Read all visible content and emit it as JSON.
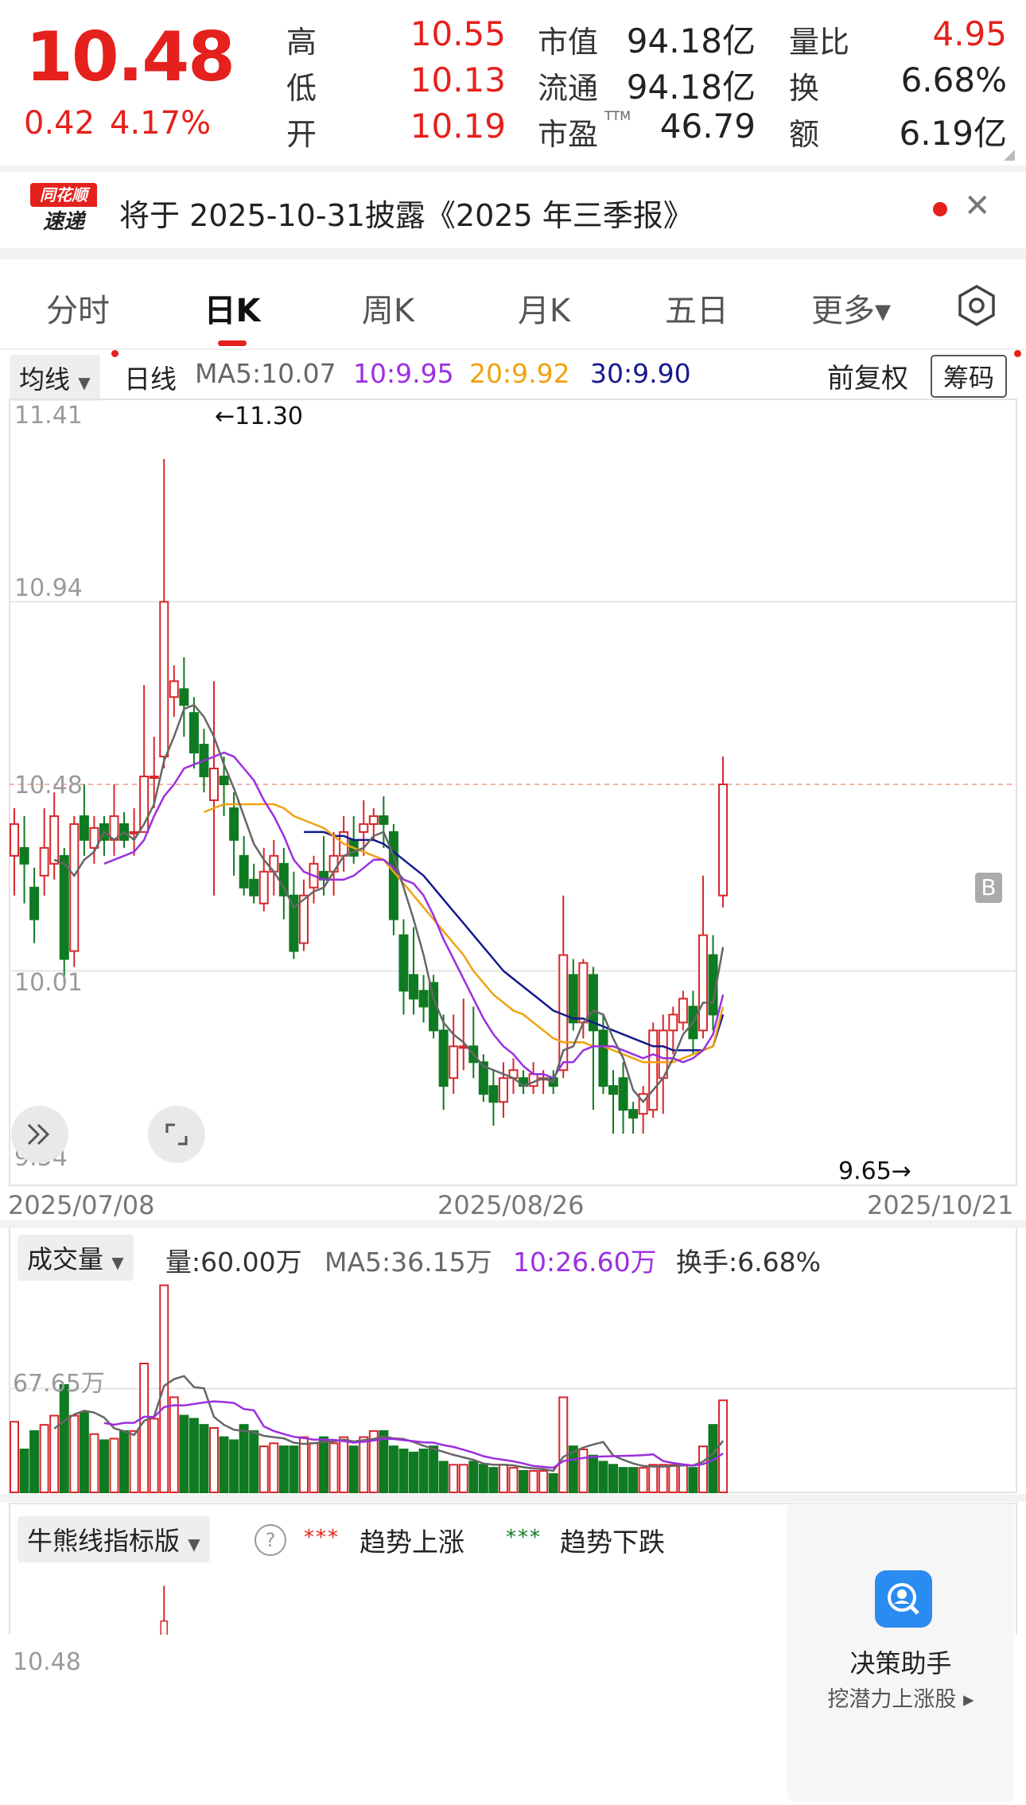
{
  "quote": {
    "price": "10.48",
    "change": "0.42",
    "change_pct": "4.17%",
    "stats": [
      {
        "label": "高",
        "value": "10.55",
        "color": "red"
      },
      {
        "label": "低",
        "value": "10.13",
        "color": "red"
      },
      {
        "label": "开",
        "value": "10.19",
        "color": "red"
      },
      {
        "label": "市值",
        "value": "94.18亿",
        "color": "dark"
      },
      {
        "label": "流通",
        "value": "94.18亿",
        "color": "dark"
      },
      {
        "label": "市盈",
        "value": "46.79",
        "color": "dark"
      },
      {
        "label": "量比",
        "value": "4.95",
        "color": "red"
      },
      {
        "label": "换",
        "value": "6.68%",
        "color": "dark"
      },
      {
        "label": "额",
        "value": "6.19亿",
        "color": "dark"
      }
    ],
    "ttm": "TTM"
  },
  "notice": {
    "logo_top": "同花顺",
    "logo_bottom": "速递",
    "text": "将于 2025-10-31披露《2025 年三季报》"
  },
  "tabs": [
    "分时",
    "日K",
    "周K",
    "月K",
    "五日",
    "更多▾"
  ],
  "active_tab": "日K",
  "kline": {
    "ma_selector": "均线",
    "period_label": "日线",
    "ma5": "MA5:10.07",
    "ma10": "10:9.95",
    "ma20": "20:9.92",
    "ma30": "30:9.90",
    "adjust": "前复权",
    "chips": "筹码",
    "y_ticks": [
      "11.41",
      "10.94",
      "10.48",
      "10.01",
      "9.54"
    ],
    "max_label": "←11.30",
    "min_label": "9.65→",
    "b_marker": "B",
    "dates": [
      "2025/07/08",
      "2025/08/26",
      "2025/10/21"
    ]
  },
  "volume": {
    "selector": "成交量",
    "vol": "量:60.00万",
    "ma5": "MA5:36.15万",
    "ma10": "10:26.60万",
    "turnover": "换手:6.68%",
    "y_tick": "67.65万"
  },
  "bullbear": {
    "selector": "牛熊线指标版",
    "help": "?",
    "legend_up": "趋势上涨",
    "legend_down": "趋势下跌",
    "y_tick": "10.48"
  },
  "helper": {
    "title": "决策助手",
    "subtitle": "挖潜力上涨股 ▸"
  },
  "colors": {
    "up": "#d8262b",
    "down": "#0e7a21",
    "ma5": "#666666",
    "ma10": "#9b30e0",
    "ma20": "#f0a20f",
    "ma30": "#151a8c"
  },
  "chart_data": {
    "type": "candlestick",
    "y_range": [
      9.54,
      11.41
    ],
    "dates": [
      "2025/07/08",
      "2025/08/26",
      "2025/10/21"
    ],
    "candles": [
      [
        10.3,
        10.38,
        10.2,
        10.42
      ],
      [
        10.32,
        10.28,
        10.18,
        10.4
      ],
      [
        10.22,
        10.14,
        10.08,
        10.27
      ],
      [
        10.25,
        10.32,
        10.2,
        10.42
      ],
      [
        10.28,
        10.4,
        10.24,
        10.46
      ],
      [
        10.3,
        10.04,
        9.98,
        10.32
      ],
      [
        10.06,
        10.38,
        10.02,
        10.4
      ],
      [
        10.4,
        10.34,
        10.3,
        10.48
      ],
      [
        10.32,
        10.37,
        10.28,
        10.4
      ],
      [
        10.38,
        10.34,
        10.3,
        10.4
      ],
      [
        10.34,
        10.4,
        10.3,
        10.48
      ],
      [
        10.38,
        10.34,
        10.32,
        10.41
      ],
      [
        10.36,
        10.36,
        10.3,
        10.42
      ],
      [
        10.36,
        10.5,
        10.44,
        10.73
      ],
      [
        10.5,
        10.5,
        10.42,
        10.6
      ],
      [
        10.55,
        10.94,
        10.52,
        11.3
      ],
      [
        10.7,
        10.74,
        10.65,
        10.78
      ],
      [
        10.72,
        10.68,
        10.6,
        10.8
      ],
      [
        10.66,
        10.56,
        10.52,
        10.7
      ],
      [
        10.58,
        10.5,
        10.46,
        10.62
      ],
      [
        10.44,
        10.52,
        10.2,
        10.74
      ],
      [
        10.5,
        10.48,
        10.4,
        10.55
      ],
      [
        10.42,
        10.34,
        10.25,
        10.46
      ],
      [
        10.3,
        10.22,
        10.2,
        10.35
      ],
      [
        10.24,
        10.2,
        10.18,
        10.28
      ],
      [
        10.18,
        10.26,
        10.16,
        10.32
      ],
      [
        10.26,
        10.3,
        10.2,
        10.34
      ],
      [
        10.28,
        10.2,
        10.14,
        10.32
      ],
      [
        10.2,
        10.06,
        10.04,
        10.26
      ],
      [
        10.08,
        10.2,
        10.06,
        10.24
      ],
      [
        10.22,
        10.28,
        10.18,
        10.3
      ],
      [
        10.26,
        10.24,
        10.2,
        10.35
      ],
      [
        10.26,
        10.3,
        10.2,
        10.36
      ],
      [
        10.3,
        10.36,
        10.26,
        10.4
      ],
      [
        10.34,
        10.3,
        10.28,
        10.4
      ],
      [
        10.36,
        10.38,
        10.3,
        10.44
      ],
      [
        10.38,
        10.4,
        10.34,
        10.42
      ],
      [
        10.4,
        10.38,
        10.32,
        10.45
      ],
      [
        10.36,
        10.14,
        10.1,
        10.38
      ],
      [
        10.1,
        9.96,
        9.9,
        10.14
      ],
      [
        10.0,
        9.94,
        9.9,
        10.12
      ],
      [
        9.96,
        9.92,
        9.88,
        10.0
      ],
      [
        9.98,
        9.86,
        9.84,
        10.0
      ],
      [
        9.86,
        9.72,
        9.66,
        9.9
      ],
      [
        9.74,
        9.82,
        9.7,
        9.9
      ],
      [
        9.82,
        9.82,
        9.76,
        9.94
      ],
      [
        9.82,
        9.78,
        9.74,
        9.92
      ],
      [
        9.78,
        9.7,
        9.68,
        9.8
      ],
      [
        9.72,
        9.68,
        9.62,
        9.76
      ],
      [
        9.68,
        9.74,
        9.64,
        9.78
      ],
      [
        9.74,
        9.76,
        9.7,
        9.79
      ],
      [
        9.74,
        9.72,
        9.7,
        9.76
      ],
      [
        9.72,
        9.75,
        9.7,
        9.78
      ],
      [
        9.74,
        9.74,
        9.7,
        9.76
      ],
      [
        9.74,
        9.72,
        9.7,
        9.76
      ],
      [
        9.76,
        10.05,
        9.74,
        10.2
      ],
      [
        10.0,
        9.88,
        9.86,
        10.04
      ],
      [
        9.88,
        10.03,
        9.84,
        10.04
      ],
      [
        10.0,
        9.86,
        9.66,
        10.02
      ],
      [
        9.86,
        9.72,
        9.7,
        9.9
      ],
      [
        9.72,
        9.7,
        9.6,
        9.76
      ],
      [
        9.74,
        9.66,
        9.6,
        9.78
      ],
      [
        9.66,
        9.64,
        9.6,
        9.68
      ],
      [
        9.65,
        9.7,
        9.6,
        9.72
      ],
      [
        9.66,
        9.86,
        9.64,
        9.88
      ],
      [
        9.74,
        9.86,
        9.65,
        9.9
      ],
      [
        9.86,
        9.9,
        9.8,
        9.92
      ],
      [
        9.88,
        9.94,
        9.86,
        9.96
      ],
      [
        9.92,
        9.84,
        9.8,
        9.96
      ],
      [
        9.86,
        10.1,
        9.84,
        10.25
      ],
      [
        10.05,
        9.9,
        9.86,
        10.1
      ],
      [
        10.2,
        10.48,
        10.17,
        10.55
      ]
    ],
    "volume": [
      46,
      28,
      40,
      44,
      50,
      70,
      50,
      52,
      38,
      34,
      35,
      40,
      40,
      84,
      48,
      135,
      62,
      50,
      48,
      44,
      42,
      36,
      34,
      44,
      40,
      30,
      32,
      30,
      30,
      36,
      32,
      36,
      32,
      36,
      30,
      36,
      40,
      40,
      30,
      28,
      26,
      28,
      30,
      20,
      18,
      18,
      20,
      18,
      16,
      18,
      16,
      14,
      14,
      14,
      12,
      62,
      30,
      28,
      24,
      20,
      18,
      16,
      16,
      16,
      18,
      18,
      18,
      18,
      16,
      30,
      44,
      60
    ],
    "ma5": [
      null,
      null,
      null,
      null,
      10.29,
      10.28,
      10.25,
      10.29,
      10.31,
      10.36,
      10.34,
      10.36,
      10.34,
      10.38,
      10.43,
      10.54,
      10.6,
      10.67,
      10.68,
      10.65,
      10.6,
      10.53,
      10.47,
      10.4,
      10.33,
      10.29,
      10.26,
      10.22,
      10.17,
      10.19,
      10.21,
      10.22,
      10.26,
      10.3,
      10.31,
      10.32,
      10.35,
      10.36,
      10.3,
      10.22,
      10.14,
      10.05,
      9.94,
      9.88,
      9.85,
      9.83,
      9.8,
      9.77,
      9.76,
      9.75,
      9.74,
      9.72,
      9.73,
      9.74,
      9.73,
      9.81,
      9.82,
      9.88,
      9.91,
      9.9,
      9.84,
      9.79,
      9.71,
      9.68,
      9.71,
      9.74,
      9.79,
      9.85,
      9.88,
      9.93,
      9.93,
      10.07
    ],
    "ma10": [
      null,
      null,
      null,
      null,
      null,
      null,
      null,
      null,
      null,
      10.28,
      10.29,
      10.3,
      10.31,
      10.34,
      10.4,
      10.45,
      10.48,
      10.52,
      10.53,
      10.54,
      10.55,
      10.56,
      10.55,
      10.52,
      10.49,
      10.44,
      10.4,
      10.35,
      10.29,
      10.26,
      10.25,
      10.24,
      10.24,
      10.24,
      10.25,
      10.27,
      10.29,
      10.29,
      10.27,
      10.24,
      10.23,
      10.2,
      10.15,
      10.09,
      10.04,
      9.99,
      9.94,
      9.89,
      9.85,
      9.82,
      9.8,
      9.77,
      9.75,
      9.75,
      9.74,
      9.78,
      9.78,
      9.81,
      9.82,
      9.82,
      9.82,
      9.81,
      9.8,
      9.79,
      9.8,
      9.79,
      9.79,
      9.78,
      9.79,
      9.81,
      9.85,
      9.95
    ],
    "ma20": [
      null,
      null,
      null,
      null,
      null,
      null,
      null,
      null,
      null,
      null,
      null,
      null,
      null,
      null,
      null,
      null,
      null,
      null,
      null,
      10.41,
      10.42,
      10.43,
      10.43,
      10.43,
      10.43,
      10.43,
      10.43,
      10.42,
      10.4,
      10.39,
      10.38,
      10.37,
      10.35,
      10.33,
      10.32,
      10.31,
      10.3,
      10.29,
      10.26,
      10.23,
      10.2,
      10.17,
      10.14,
      10.11,
      10.08,
      10.05,
      10.01,
      9.98,
      9.95,
      9.93,
      9.91,
      9.9,
      9.88,
      9.86,
      9.84,
      9.83,
      9.83,
      9.83,
      9.82,
      9.82,
      9.81,
      9.8,
      9.79,
      9.78,
      9.78,
      9.78,
      9.78,
      9.79,
      9.8,
      9.81,
      9.82,
      9.92
    ],
    "ma30": [
      null,
      null,
      null,
      null,
      null,
      null,
      null,
      null,
      null,
      null,
      null,
      null,
      null,
      null,
      null,
      null,
      null,
      null,
      null,
      null,
      null,
      null,
      null,
      null,
      null,
      null,
      null,
      null,
      null,
      10.36,
      10.36,
      10.36,
      10.35,
      10.35,
      10.34,
      10.34,
      10.34,
      10.33,
      10.31,
      10.29,
      10.27,
      10.25,
      10.22,
      10.19,
      10.16,
      10.13,
      10.1,
      10.07,
      10.04,
      10.01,
      9.99,
      9.97,
      9.95,
      9.93,
      9.91,
      9.9,
      9.89,
      9.89,
      9.88,
      9.87,
      9.86,
      9.85,
      9.84,
      9.83,
      9.82,
      9.82,
      9.81,
      9.81,
      9.81,
      9.81,
      9.82,
      9.9
    ]
  }
}
